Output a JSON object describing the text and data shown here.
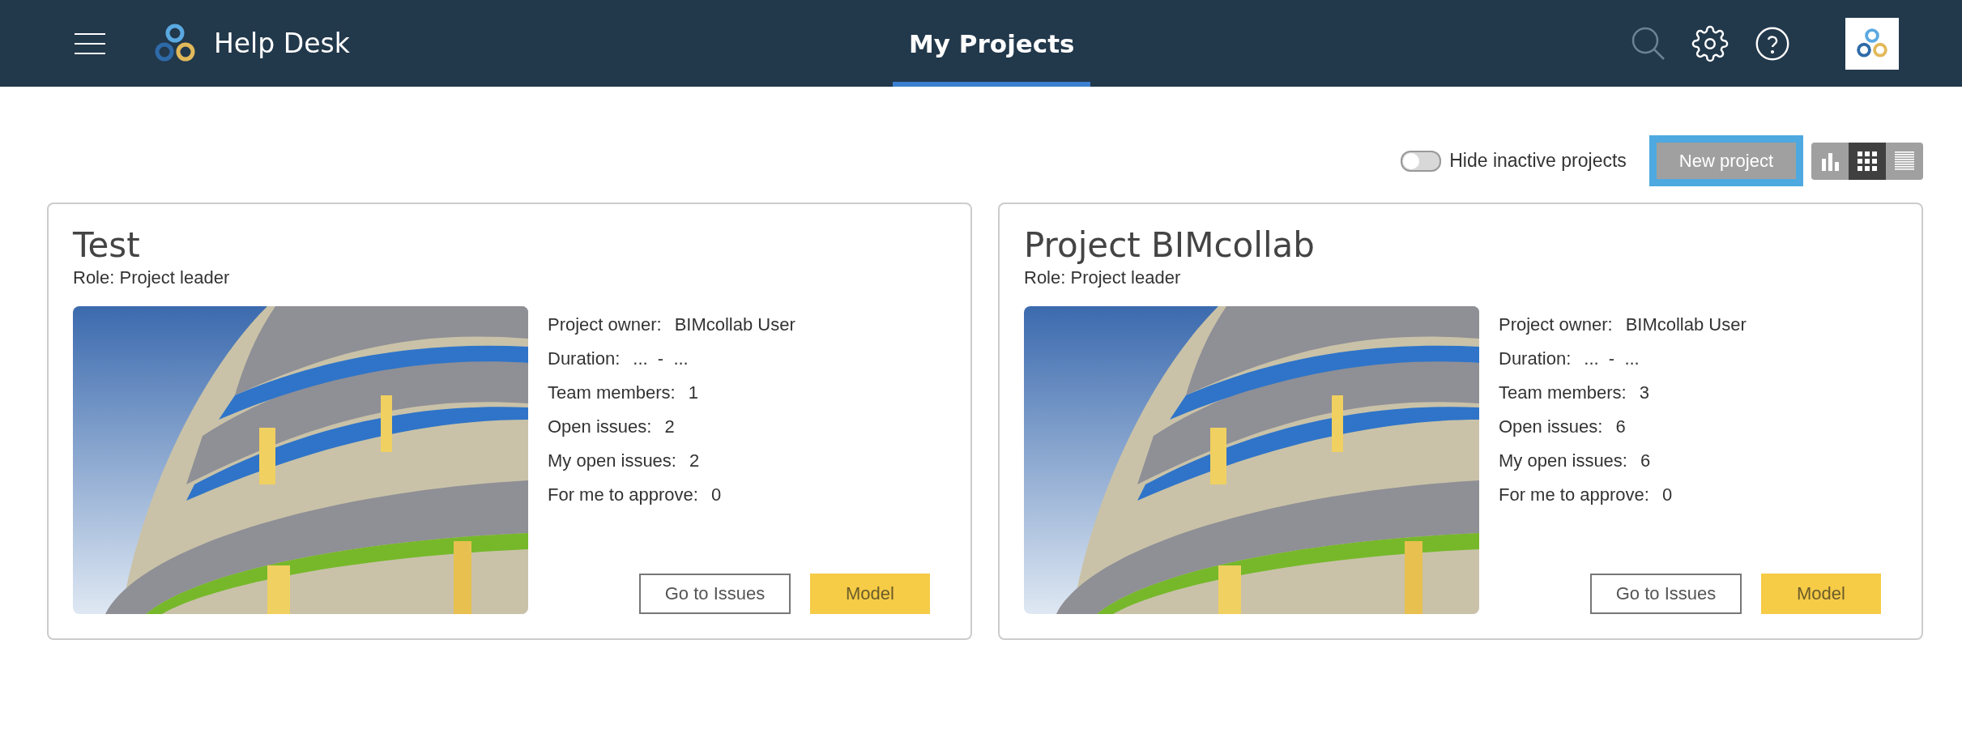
{
  "header": {
    "app_name": "Help Desk",
    "tabs": [
      {
        "label": "My Projects",
        "selected": true
      }
    ]
  },
  "toolbar": {
    "hide_inactive": {
      "label": "Hide inactive projects",
      "on": false
    },
    "new_project": "New project",
    "views": [
      {
        "kind": "chart",
        "selected": false
      },
      {
        "kind": "grid",
        "selected": true
      },
      {
        "kind": "list",
        "selected": false
      }
    ]
  },
  "projects": [
    {
      "title": "Test",
      "role": "Role: Project leader",
      "picture": {
        "kind": "picture"
      },
      "stats": [
        {
          "label": "Project owner:",
          "value": "BIMcollab User"
        },
        {
          "label": "Duration:",
          "value": "...  -  ..."
        },
        {
          "label": "Team members:",
          "value": "1"
        },
        {
          "label": "Open issues:",
          "value": "2"
        },
        {
          "label": "My open issues:",
          "value": "2"
        },
        {
          "label": "For me to approve:",
          "value": "0"
        }
      ],
      "buttons": [
        "Go to Issues",
        "Model"
      ]
    },
    {
      "title": "Project BIMcollab",
      "role": "Role: Project leader",
      "picture": {
        "kind": "picture"
      },
      "stats": [
        {
          "label": "Project owner:",
          "value": "BIMcollab User"
        },
        {
          "label": "Duration:",
          "value": "...  -  ..."
        },
        {
          "label": "Team members:",
          "value": "3"
        },
        {
          "label": "Open issues:",
          "value": "6"
        },
        {
          "label": "My open issues:",
          "value": "6"
        },
        {
          "label": "For me to approve:",
          "value": "0"
        }
      ],
      "buttons": [
        "Go to Issues",
        "Model"
      ]
    }
  ]
}
